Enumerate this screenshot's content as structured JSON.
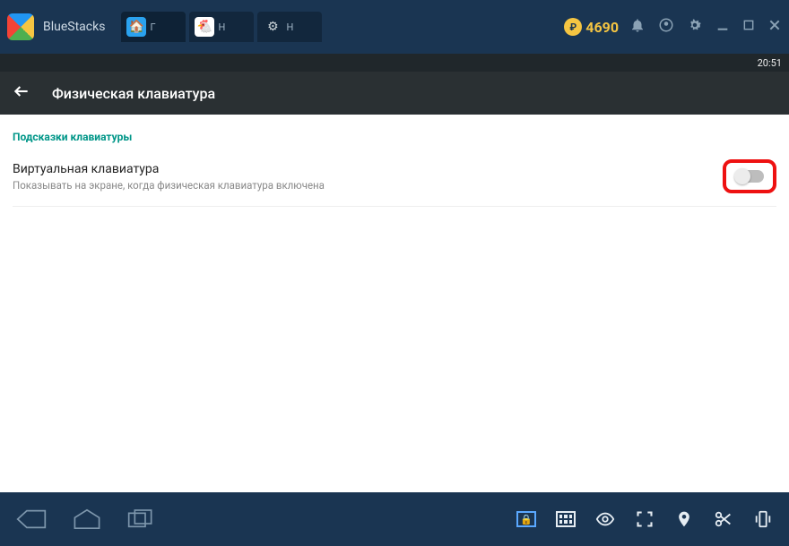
{
  "titlebar": {
    "brand": "BlueStacks",
    "tabs": [
      {
        "label": "Г",
        "icon_bg": "#2aa2ef"
      },
      {
        "label": "Н",
        "icon_bg": "#ffffff"
      },
      {
        "label": "Н",
        "icon_bg": "#3a3a3a"
      }
    ],
    "coin_value": "4690"
  },
  "status": {
    "time": "20:51"
  },
  "appbar": {
    "title": "Физическая клавиатура"
  },
  "content": {
    "section_header": "Подсказки клавиатуры",
    "setting": {
      "title": "Виртуальная клавиатура",
      "subtitle": "Показывать на экране, когда физическая клавиатура включена"
    }
  }
}
